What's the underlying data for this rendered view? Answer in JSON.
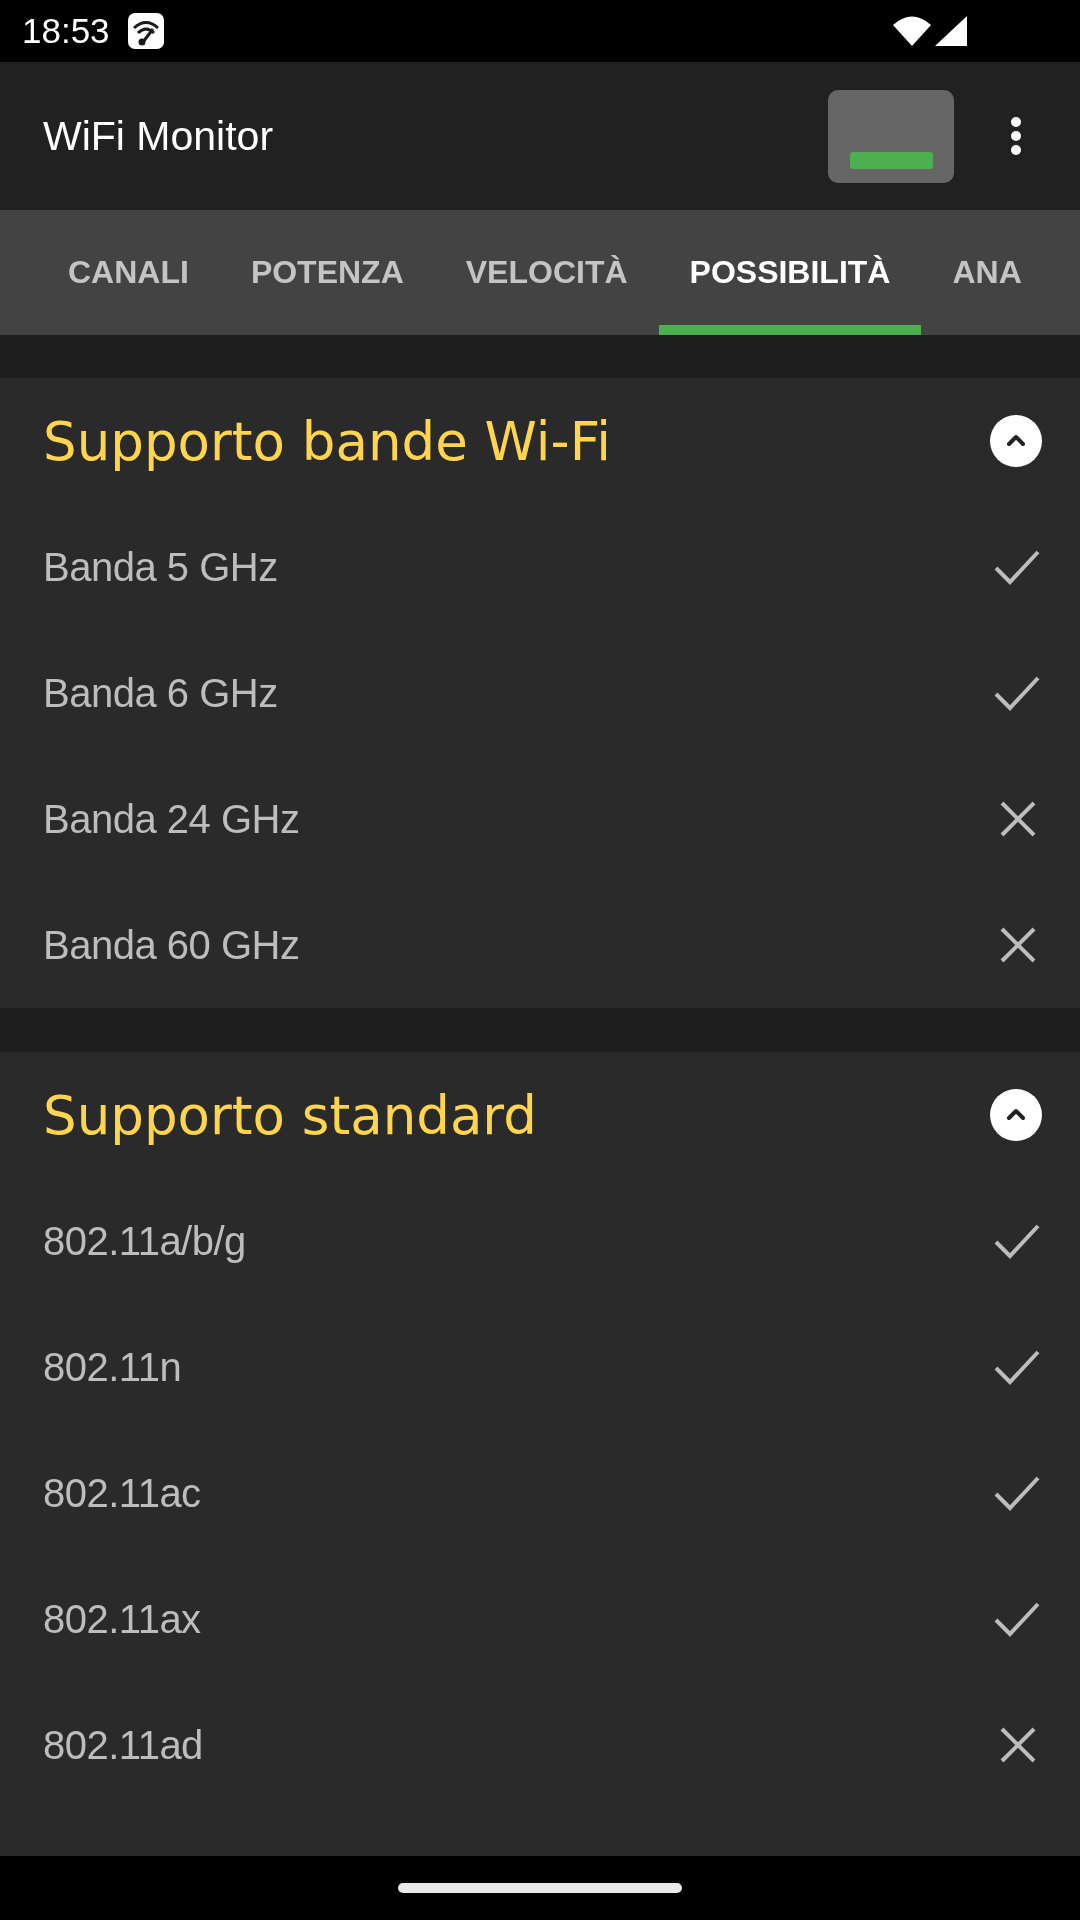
{
  "status_bar": {
    "time": "18:53"
  },
  "app_bar": {
    "title": "WiFi Monitor"
  },
  "tabs": [
    {
      "label": "CANALI",
      "selected": false
    },
    {
      "label": "POTENZA",
      "selected": false
    },
    {
      "label": "VELOCITÀ",
      "selected": false
    },
    {
      "label": "POSSIBILITÀ",
      "selected": true
    },
    {
      "label": "ANA",
      "selected": false
    }
  ],
  "sections": [
    {
      "title": "Supporto bande Wi-Fi",
      "expanded": true,
      "items": [
        {
          "label": "Banda 5 GHz",
          "supported": true
        },
        {
          "label": "Banda 6 GHz",
          "supported": true
        },
        {
          "label": "Banda 24 GHz",
          "supported": false
        },
        {
          "label": "Banda 60 GHz",
          "supported": false
        }
      ]
    },
    {
      "title": "Supporto standard",
      "expanded": true,
      "items": [
        {
          "label": "802.11a/b/g",
          "supported": true
        },
        {
          "label": "802.11n",
          "supported": true
        },
        {
          "label": "802.11ac",
          "supported": true
        },
        {
          "label": "802.11ax",
          "supported": true
        },
        {
          "label": "802.11ad",
          "supported": false
        }
      ]
    }
  ]
}
